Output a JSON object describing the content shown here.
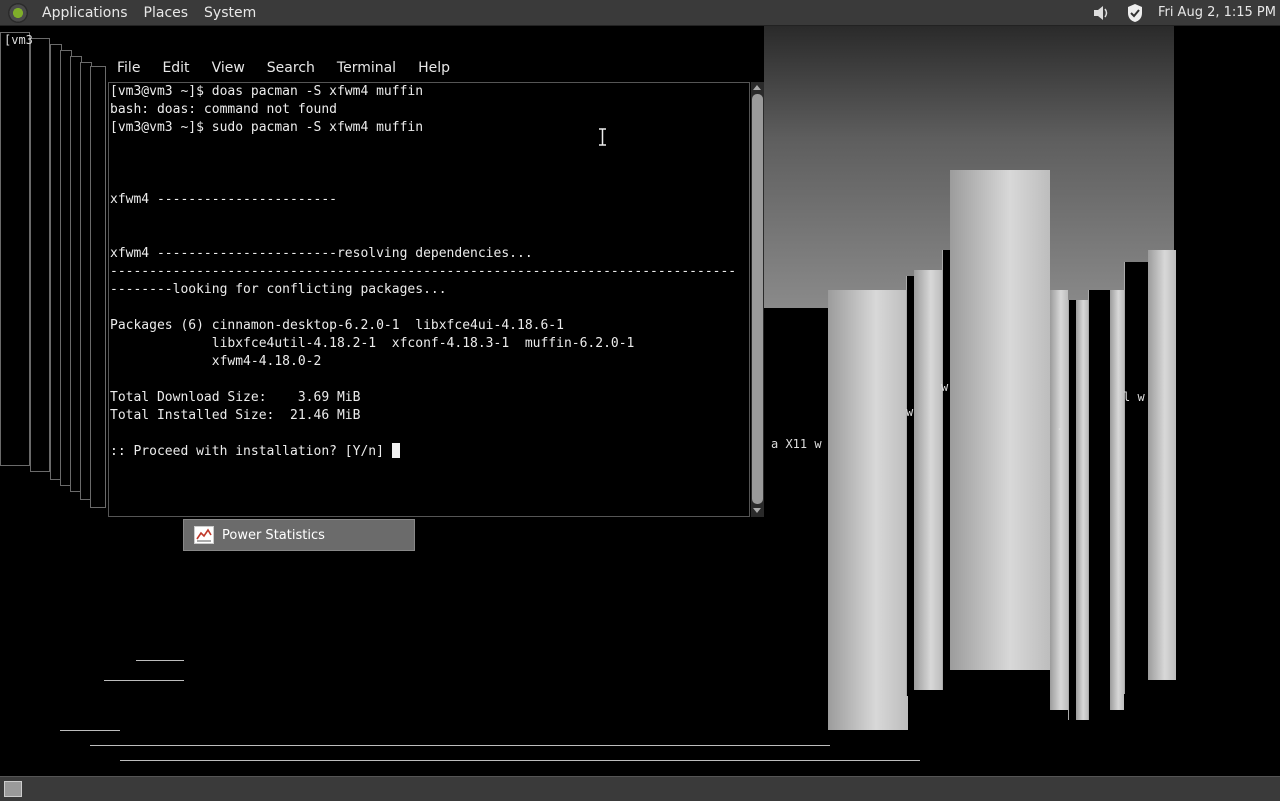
{
  "top_panel": {
    "menus": [
      "Applications",
      "Places",
      "System"
    ],
    "clock": "Fri Aug  2,  1:15 PM",
    "tray_icons": [
      "volume-icon",
      "shield-icon"
    ]
  },
  "terminal": {
    "menus": [
      "File",
      "Edit",
      "View",
      "Search",
      "Terminal",
      "Help"
    ],
    "lines": [
      "[vm3@vm3 ~]$ doas pacman -S xfwm4 muffin",
      "bash: doas: command not found",
      "[vm3@vm3 ~]$ sudo pacman -S xfwm4 muffin",
      "",
      "",
      "",
      "xfwm4 -----------------------",
      "",
      "",
      "xfwm4 -----------------------resolving dependencies...",
      "--------------------------------------------------------------------------------",
      "--------looking for conflicting packages...",
      "",
      "Packages (6) cinnamon-desktop-6.2.0-1  libxfce4ui-4.18.6-1",
      "             libxfce4util-4.18.2-1  xfconf-4.18.3-1  muffin-6.2.0-1",
      "             xfwm4-4.18.0-2",
      "",
      "Total Download Size:    3.69 MiB",
      "Total Installed Size:  21.46 MiB",
      "",
      ":: Proceed with installation? [Y/n] "
    ]
  },
  "taskbar_item": {
    "label": "Power Statistics"
  },
  "desktop_artifacts": {
    "prompt_fragment": "[vm3",
    "window_fragments": [
      "a X11 w",
      "w",
      "w",
      ". w",
      "l w"
    ]
  }
}
